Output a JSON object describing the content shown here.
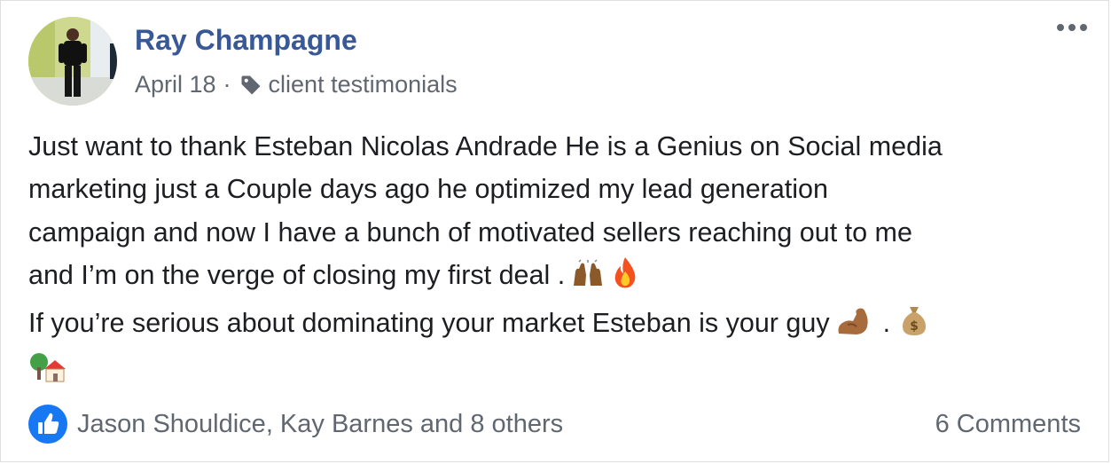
{
  "post": {
    "author": "Ray Champagne",
    "date": "April 18",
    "separator": "·",
    "topic": "client testimonials",
    "lines": [
      "Just want to thank Esteban Nicolas Andrade He is a Genius on Social media",
      "marketing just a Couple days ago he optimized my lead generation",
      "campaign and now I have a bunch of motivated sellers reaching out to me",
      "and I’m on the verge of closing my first deal .",
      "If you’re serious about dominating your market Esteban is your guy",
      "."
    ],
    "emoji_icons": [
      "raising-hands-icon",
      "fire-icon",
      "flexed-biceps-icon",
      "money-bag-icon",
      "house-with-garden-icon"
    ]
  },
  "footer": {
    "reactions": "Jason Shouldice, Kay Barnes and 8 others",
    "comments": "6 Comments"
  },
  "colors": {
    "author": "#385898",
    "meta": "#606770",
    "like_blue": "#1877f2",
    "border": "#dddfe2"
  }
}
